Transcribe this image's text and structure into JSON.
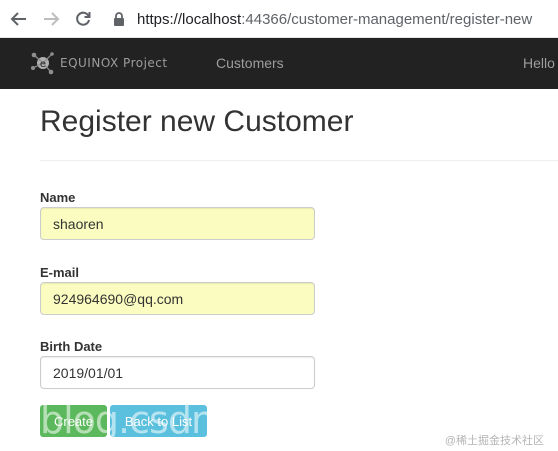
{
  "browser": {
    "url_host": "https://localhost",
    "url_rest": ":44366/customer-management/register-new"
  },
  "navbar": {
    "brand": "EQUINOX Project",
    "customers_link": "Customers",
    "hello_link": "Hello"
  },
  "page": {
    "title": "Register new Customer"
  },
  "form": {
    "name_label": "Name",
    "name_value": "shaoren",
    "email_label": "E-mail",
    "email_value": "924964690@qq.com",
    "birth_label": "Birth Date",
    "birth_value": "2019/01/01"
  },
  "buttons": {
    "create": "Create",
    "back": "Back to List"
  },
  "watermarks": {
    "blog": "blog.csdn",
    "corner": "@稀土掘金技术社区"
  },
  "colors": {
    "navbar": "#222222",
    "autofill": "#fafdbf",
    "create_button": "#5cb85c",
    "back_button": "#5bc0de"
  }
}
